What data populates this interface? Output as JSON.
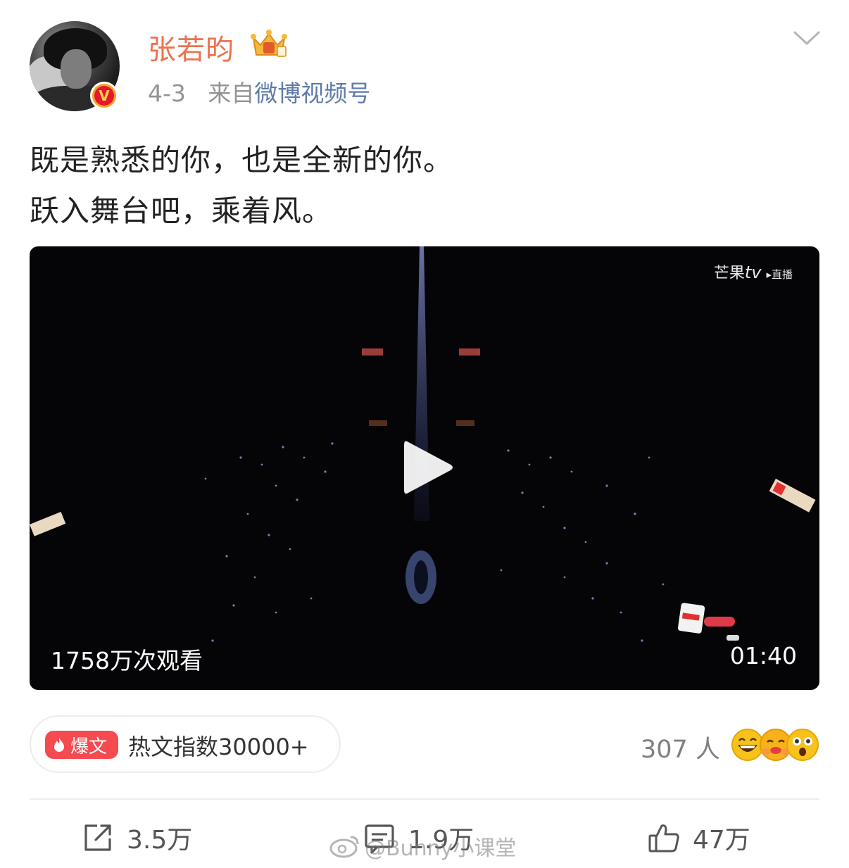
{
  "author": {
    "name": "张若昀",
    "date": "4-3",
    "source_prefix": "来自",
    "source": "微博视频号",
    "verified_mark": "V"
  },
  "post": {
    "line1": "既是熟悉的你，也是全新的你。",
    "line2": "跃入舞台吧，乘着风。"
  },
  "video": {
    "views": "1758万次观看",
    "duration": "01:40",
    "watermark_brand": "芒果",
    "watermark_tv": "tv",
    "watermark_live": "▸直播"
  },
  "hot": {
    "tag": "爆文",
    "index_text": "热文指数30000+"
  },
  "reactions": {
    "count": "307 人",
    "icons": [
      "grinning-emoji-icon",
      "hug-emoji-icon",
      "surprised-emoji-icon"
    ]
  },
  "actions": {
    "repost": "3.5万",
    "comment": "1.9万",
    "like": "47万"
  },
  "watermark": {
    "text": "@Bunny小课堂"
  },
  "colors": {
    "username": "#eb7350",
    "source_link": "#5d7ba8",
    "hot_tag": "#f44a50",
    "verified_outer": "#f5a623",
    "verified_inner": "#e6162d"
  }
}
